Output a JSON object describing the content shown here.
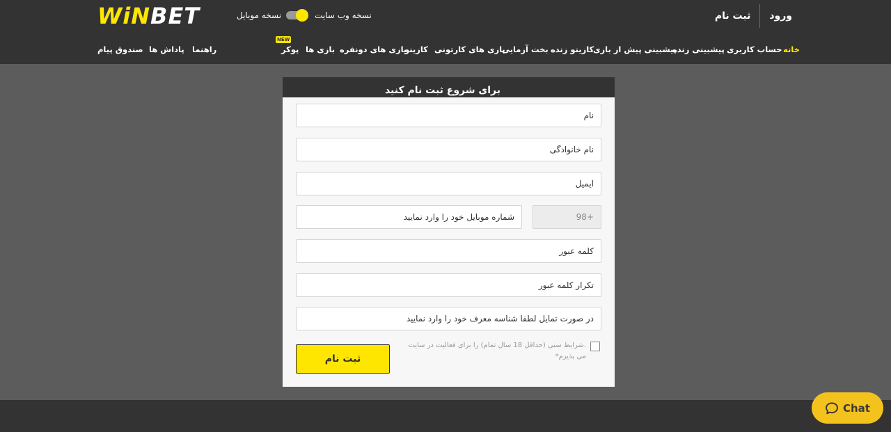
{
  "header": {
    "logo_part_a": "WiN",
    "logo_part_b": "BET",
    "version_web": "نسخه وب سایت",
    "version_mobile": "نسخه موبایل",
    "login": "ورود",
    "register": "ثبت نام"
  },
  "nav": {
    "items": [
      {
        "label": "خانه",
        "active": true
      },
      {
        "label": "حساب کاربری"
      },
      {
        "label": "پیشبینی زنده"
      },
      {
        "label": "پیشبینی پیش از بازی"
      },
      {
        "label": "کازینو زنده"
      },
      {
        "label": "بخت آزمایی"
      },
      {
        "label": "بازی های کارتونی"
      },
      {
        "label": "کازینو"
      },
      {
        "label": "بازی های دونفره"
      },
      {
        "label": "بازی ها"
      },
      {
        "label": "پوکر"
      },
      {
        "label": "راهنما"
      },
      {
        "label": "پاداش ها"
      },
      {
        "label": "صندوق پیام"
      }
    ],
    "badge": "NEW"
  },
  "form": {
    "title": "برای شروع ثبت نام کنید",
    "first_name_placeholder": "نام",
    "last_name_placeholder": "نام خانوادگی",
    "email_placeholder": "ایمیل",
    "country_code": "+98",
    "phone_placeholder": "شماره موبایل خود را وارد نمایید",
    "password_placeholder": "کلمه عبور",
    "password_repeat_placeholder": "تکرار کلمه عبور",
    "referral_placeholder": "در صورت تمایل لطفا شناسه معرف خود را وارد نمایید",
    "terms": ".شرایط سنی (حداقل 18 سال تمام) را برای فعالیت در سایت می پذیرم*",
    "submit": "ثبت نام"
  },
  "chat": {
    "label": "Chat"
  },
  "colors": {
    "accent": "#ffe600",
    "header_bg": "#333333",
    "page_bg": "#5c5c5c",
    "chat_bg": "#f4c21d"
  },
  "icons": [
    "toggle-switch",
    "chat-bubble-icon"
  ]
}
